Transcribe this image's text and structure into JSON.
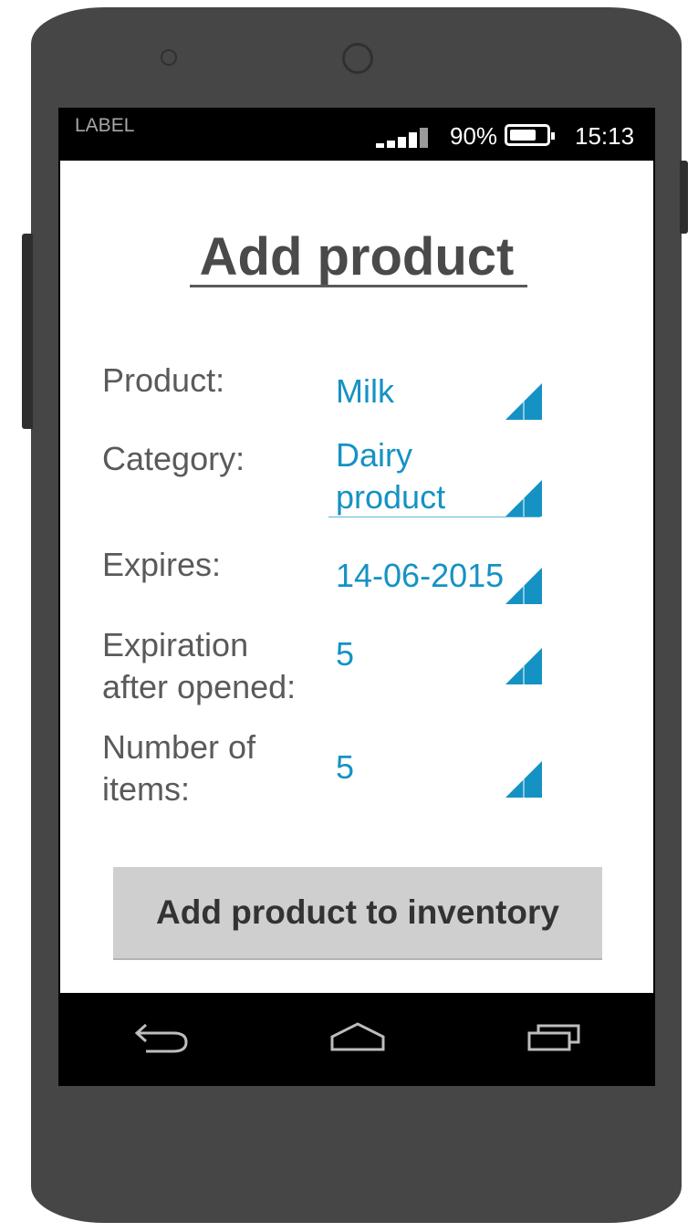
{
  "status": {
    "label": "LABEL",
    "battery_percent": "90%",
    "battery_level": 0.9,
    "time": "15:13",
    "signal_bars": 5
  },
  "page": {
    "title": "Add product"
  },
  "form": {
    "fields": [
      {
        "label": "Product:",
        "value": "Milk"
      },
      {
        "label": "Category:",
        "value_line1": "Dairy",
        "value_line2": "product"
      },
      {
        "label": "Expires:",
        "value": "14-06-2015"
      },
      {
        "label_line1": "Expiration",
        "label_line2": "after opened:",
        "value": "5"
      },
      {
        "label_line1": "Number of",
        "label_line2": "items:",
        "value": "5"
      }
    ]
  },
  "actions": {
    "add_button_label": "Add product to inventory"
  },
  "navbar": {
    "icons": [
      "back-icon",
      "home-icon",
      "recent-apps-icon"
    ]
  },
  "colors": {
    "accent": "#1592C4",
    "phone_body": "#464646",
    "button_bg": "#CFCFCF"
  }
}
